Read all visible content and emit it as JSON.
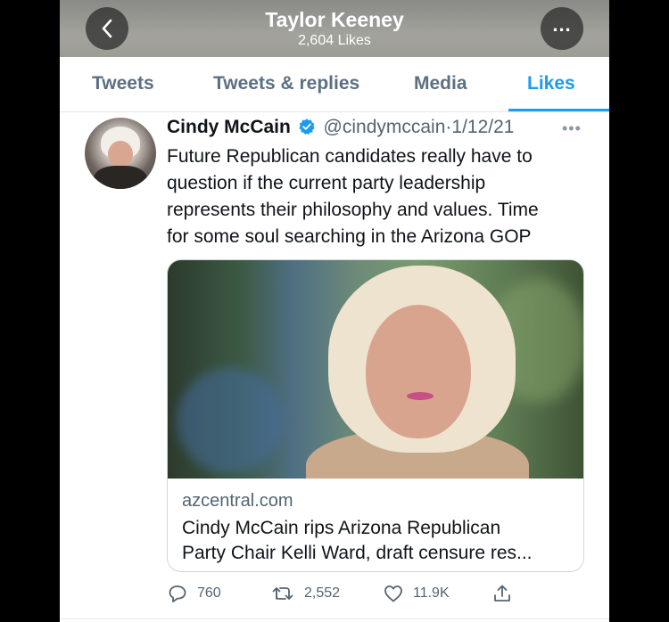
{
  "header": {
    "title": "Taylor Keeney",
    "subtitle": "2,604 Likes"
  },
  "tabs": [
    {
      "label": "Tweets"
    },
    {
      "label": "Tweets & replies"
    },
    {
      "label": "Media"
    },
    {
      "label": "Likes"
    }
  ],
  "active_tab": "Likes",
  "tweet": {
    "name": "Cindy McCain",
    "handle": "@cindymccain",
    "separator": "·",
    "date": "1/12/21",
    "text": "Future Republican candidates really have to\nquestion if the current party leadership\nrepresents their philosophy and values.  Time\nfor some soul searching in the Arizona GOP",
    "card": {
      "domain": "azcentral.com",
      "title": "Cindy McCain rips Arizona Republican\nParty Chair Kelli Ward, draft censure res..."
    },
    "stats": {
      "replies": "760",
      "retweets": "2,552",
      "likes": "11.9K"
    }
  },
  "colors": {
    "accent": "#1d9bf0",
    "secondary_text": "#536471",
    "verified": "#1d9bf0"
  },
  "icons": [
    "back-icon",
    "more-icon",
    "verified-icon",
    "reply-icon",
    "retweet-icon",
    "like-icon",
    "share-icon"
  ]
}
